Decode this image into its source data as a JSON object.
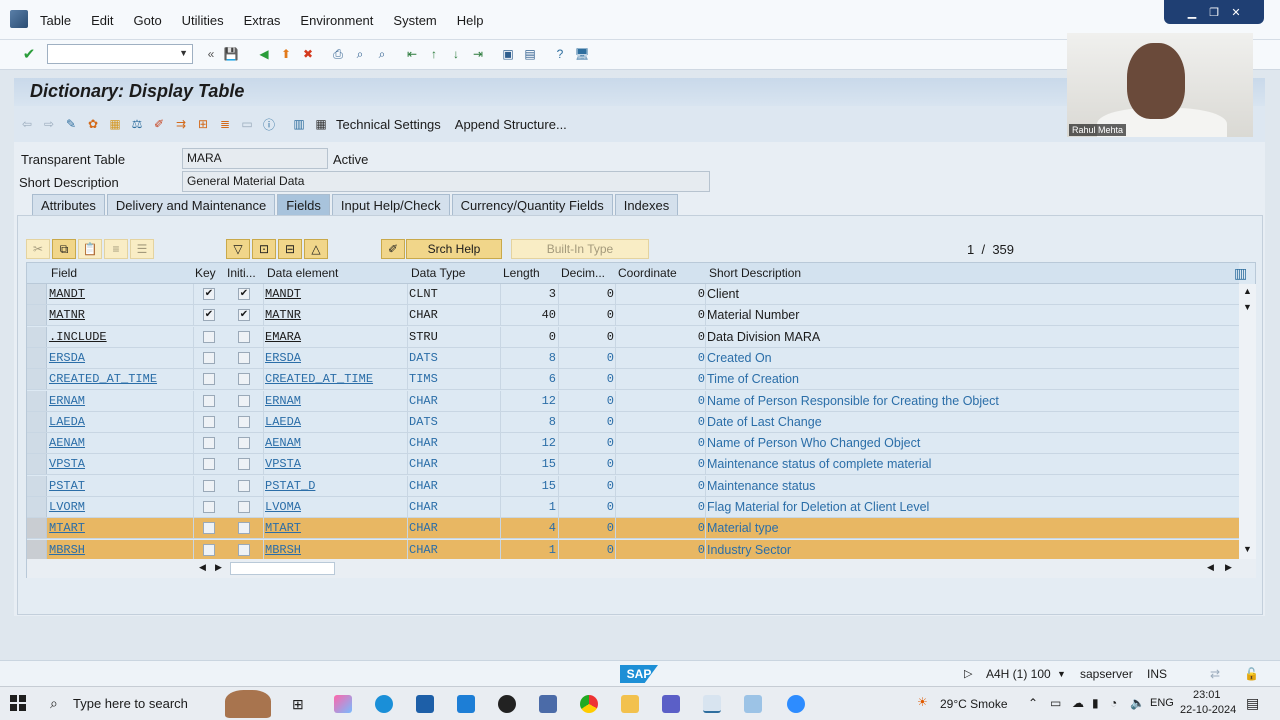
{
  "menu": [
    "Table",
    "Edit",
    "Goto",
    "Utilities",
    "Extras",
    "Environment",
    "System",
    "Help"
  ],
  "title": "Dictionary: Display Table",
  "app_toolbar": {
    "technical_settings": "Technical Settings",
    "append_structure": "Append Structure..."
  },
  "header": {
    "transparent_table_label": "Transparent Table",
    "transparent_table_value": "MARA",
    "status": "Active",
    "short_desc_label": "Short Description",
    "short_desc_value": "General Material Data"
  },
  "tabs": [
    "Attributes",
    "Delivery and Maintenance",
    "Fields",
    "Input Help/Check",
    "Currency/Quantity Fields",
    "Indexes"
  ],
  "active_tab": "Fields",
  "grid_toolbar": {
    "srch_help": "Srch Help",
    "builtin_type": "Built-In Type",
    "page_current": "1",
    "page_sep": "/",
    "page_total": "359"
  },
  "columns": [
    "Field",
    "Key",
    "Initi...",
    "Data element",
    "Data Type",
    "Length",
    "Decim...",
    "Coordinate",
    "Short Description"
  ],
  "rows": [
    {
      "field": "MANDT",
      "key": true,
      "init": true,
      "element": "MANDT",
      "type": "CLNT",
      "length": "3",
      "dec": "0",
      "coord": "0",
      "desc": "Client",
      "style": "dark",
      "sel": false
    },
    {
      "field": "MATNR",
      "key": true,
      "init": true,
      "element": "MATNR",
      "type": "CHAR",
      "length": "40",
      "dec": "0",
      "coord": "0",
      "desc": "Material Number",
      "style": "dark",
      "sel": false
    },
    {
      "field": ".INCLUDE",
      "key": false,
      "init": false,
      "element": "EMARA",
      "type": "STRU",
      "length": "0",
      "dec": "0",
      "coord": "0",
      "desc": "Data Division MARA",
      "style": "dark",
      "sel": false
    },
    {
      "field": "ERSDA",
      "key": false,
      "init": false,
      "element": "ERSDA",
      "type": "DATS",
      "length": "8",
      "dec": "0",
      "coord": "0",
      "desc": "Created On",
      "style": "blue",
      "sel": false
    },
    {
      "field": "CREATED_AT_TIME",
      "key": false,
      "init": false,
      "element": "CREATED_AT_TIME",
      "type": "TIMS",
      "length": "6",
      "dec": "0",
      "coord": "0",
      "desc": "Time of Creation",
      "style": "blue",
      "sel": false
    },
    {
      "field": "ERNAM",
      "key": false,
      "init": false,
      "element": "ERNAM",
      "type": "CHAR",
      "length": "12",
      "dec": "0",
      "coord": "0",
      "desc": "Name of Person Responsible for Creating the Object",
      "style": "blue",
      "sel": false
    },
    {
      "field": "LAEDA",
      "key": false,
      "init": false,
      "element": "LAEDA",
      "type": "DATS",
      "length": "8",
      "dec": "0",
      "coord": "0",
      "desc": "Date of Last Change",
      "style": "blue",
      "sel": false
    },
    {
      "field": "AENAM",
      "key": false,
      "init": false,
      "element": "AENAM",
      "type": "CHAR",
      "length": "12",
      "dec": "0",
      "coord": "0",
      "desc": "Name of Person Who Changed Object",
      "style": "blue",
      "sel": false
    },
    {
      "field": "VPSTA",
      "key": false,
      "init": false,
      "element": "VPSTA",
      "type": "CHAR",
      "length": "15",
      "dec": "0",
      "coord": "0",
      "desc": "Maintenance status of complete material",
      "style": "blue",
      "sel": false
    },
    {
      "field": "PSTAT",
      "key": false,
      "init": false,
      "element": "PSTAT_D",
      "type": "CHAR",
      "length": "15",
      "dec": "0",
      "coord": "0",
      "desc": "Maintenance status",
      "style": "blue",
      "sel": false
    },
    {
      "field": "LVORM",
      "key": false,
      "init": false,
      "element": "LVOMA",
      "type": "CHAR",
      "length": "1",
      "dec": "0",
      "coord": "0",
      "desc": "Flag Material for Deletion at Client Level",
      "style": "blue",
      "sel": false
    },
    {
      "field": "MTART",
      "key": false,
      "init": false,
      "element": "MTART",
      "type": "CHAR",
      "length": "4",
      "dec": "0",
      "coord": "0",
      "desc": "Material type",
      "style": "blue",
      "sel": true
    },
    {
      "field": "MBRSH",
      "key": false,
      "init": false,
      "element": "MBRSH",
      "type": "CHAR",
      "length": "1",
      "dec": "0",
      "coord": "0",
      "desc": "Industry Sector",
      "style": "blue",
      "sel": true
    }
  ],
  "statusbar": {
    "system": "A4H (1) 100",
    "server": "sapserver",
    "mode": "INS",
    "sap": "SAP"
  },
  "webcam": {
    "name": "Rahul Mehta"
  },
  "taskbar": {
    "search_placeholder": "Type here to search",
    "weather": "29°C Smoke",
    "lang": "ENG",
    "time": "23:01",
    "date": "22-10-2024"
  },
  "colors": {
    "selected_row": "#e8b763",
    "link_blue": "#2b6ea8",
    "title_bar": "#c9d9ea"
  }
}
